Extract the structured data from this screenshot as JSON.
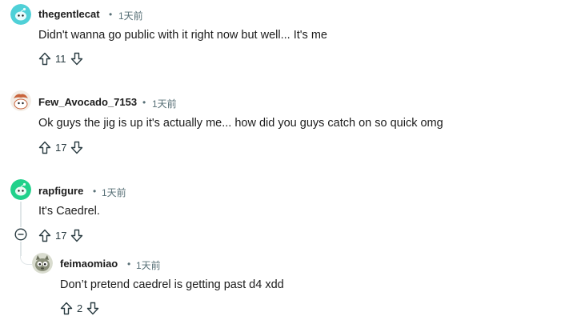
{
  "comments": [
    {
      "username": "thegentlecat",
      "dot": "•",
      "time": "1天前",
      "text": "Didn't wanna go public with it right now but well... It's me",
      "votes": "11",
      "avatar_color": "#4fd0d7"
    },
    {
      "username": "Few_Avocado_7153",
      "dot": "•",
      "time": "1天前",
      "text": "Ok guys the jig is up it's actually me... how did you guys catch on so quick omg",
      "votes": "17",
      "avatar_color": "#c8643b"
    },
    {
      "username": "rapfigure",
      "dot": "•",
      "time": "1天前",
      "text": "It's Caedrel.",
      "votes": "17",
      "avatar_color": "#21d18b"
    },
    {
      "username": "feimaomiao",
      "dot": "•",
      "time": "1天前",
      "text": "Don’t pretend caedrel is getting past d4 xdd",
      "votes": "2",
      "avatar_color": "#8a8f7a"
    }
  ],
  "icons": {
    "upvote": "upvote-icon",
    "downvote": "downvote-icon",
    "collapse": "collapse-minus-icon"
  },
  "colors": {
    "meta": "#576f76",
    "thread_line": "#e0e6e8"
  }
}
